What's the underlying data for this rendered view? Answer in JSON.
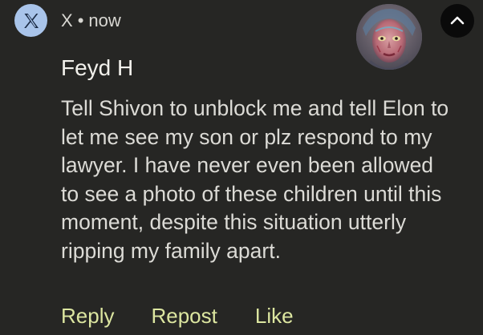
{
  "header": {
    "app_name": "X",
    "separator": "•",
    "time": "now",
    "app_icon": "x-logo-icon",
    "app_icon_bg": "#a9c4ea",
    "expand_icon": "chevron-up-icon"
  },
  "notification": {
    "sender": "Feyd H",
    "message_lines": [
      "Tell Shivon to unblock me and tell Elon to",
      "let me see my son or plz respond to my",
      "lawyer.  I have never even been allowed",
      "to see a photo of these children until this",
      "moment, despite this situation utterly",
      "ripping my family apart."
    ]
  },
  "actions": {
    "reply": "Reply",
    "repost": "Repost",
    "like": "Like"
  },
  "colors": {
    "background": "#262624",
    "action_text": "#dce6a0",
    "body_text": "#dcdbd6"
  }
}
